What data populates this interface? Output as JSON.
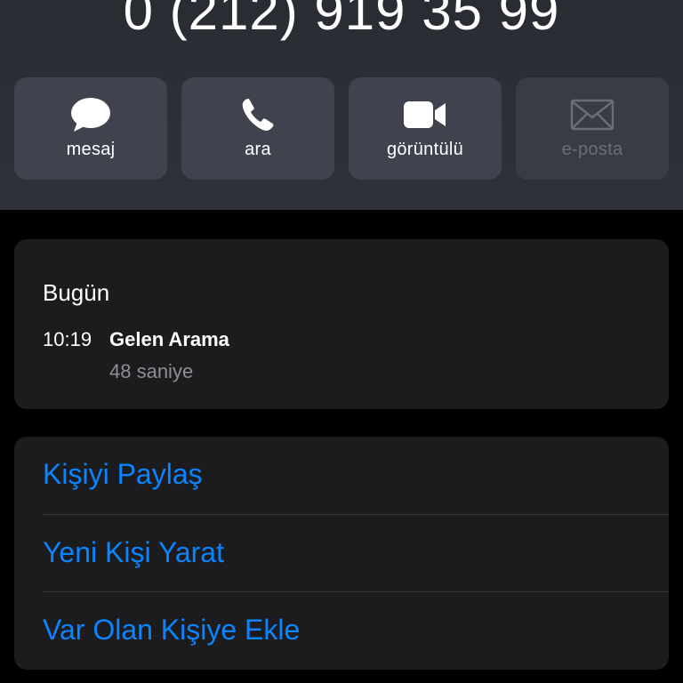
{
  "header": {
    "phone_number": "0 (212) 919 35 99"
  },
  "actions": [
    {
      "label": "mesaj",
      "icon": "message-bubble-icon",
      "enabled": true
    },
    {
      "label": "ara",
      "icon": "phone-icon",
      "enabled": true
    },
    {
      "label": "görüntülü",
      "icon": "video-camera-icon",
      "enabled": true
    },
    {
      "label": "e-posta",
      "icon": "envelope-icon",
      "enabled": false
    }
  ],
  "recents": {
    "day": "Bugün",
    "entries": [
      {
        "time": "10:19",
        "type": "Gelen Arama",
        "duration": "48 saniye"
      }
    ]
  },
  "contact_actions": [
    {
      "label": "Kişiyi Paylaş"
    },
    {
      "label": "Yeni Kişi Yarat"
    },
    {
      "label": "Var Olan Kişiye Ekle"
    }
  ],
  "colors": {
    "header_bg": "#30323b",
    "button_bg": "#40424d",
    "card_bg": "#1c1c1e",
    "accent_link": "#0a84ff",
    "secondary_text": "#8e8e93",
    "disabled_text": "#6b6d77"
  }
}
